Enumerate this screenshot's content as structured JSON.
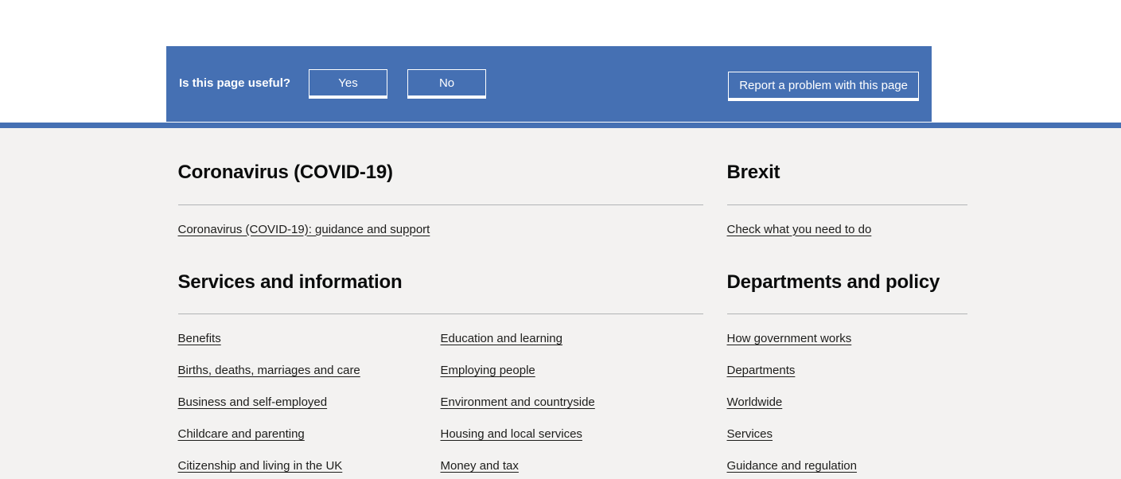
{
  "feedback": {
    "prompt": "Is this page useful?",
    "yes_label": "Yes",
    "no_label": "No",
    "report_label": "Report a problem with this page",
    "background_color": "#4570b3",
    "text_color": "#ffffff"
  },
  "theme": {
    "page_background": "#f3f2f1",
    "heading_color": "#0b0c0c",
    "link_color": "#1d1d1b",
    "rule_color": "#b1b4b6"
  },
  "sections": {
    "coronavirus": {
      "heading": "Coronavirus (COVID-19)",
      "links": [
        "Coronavirus (COVID-19): guidance and support"
      ]
    },
    "brexit": {
      "heading": "Brexit",
      "links": [
        "Check what you need to do"
      ]
    },
    "services": {
      "heading": "Services and information",
      "column_left": [
        "Benefits",
        "Births, deaths, marriages and care",
        "Business and self-employed",
        "Childcare and parenting",
        "Citizenship and living in the UK"
      ],
      "column_right": [
        "Education and learning",
        "Employing people",
        "Environment and countryside",
        "Housing and local services",
        "Money and tax"
      ]
    },
    "departments": {
      "heading": "Departments and policy",
      "links": [
        "How government works",
        "Departments",
        "Worldwide",
        "Services",
        "Guidance and regulation"
      ]
    }
  }
}
